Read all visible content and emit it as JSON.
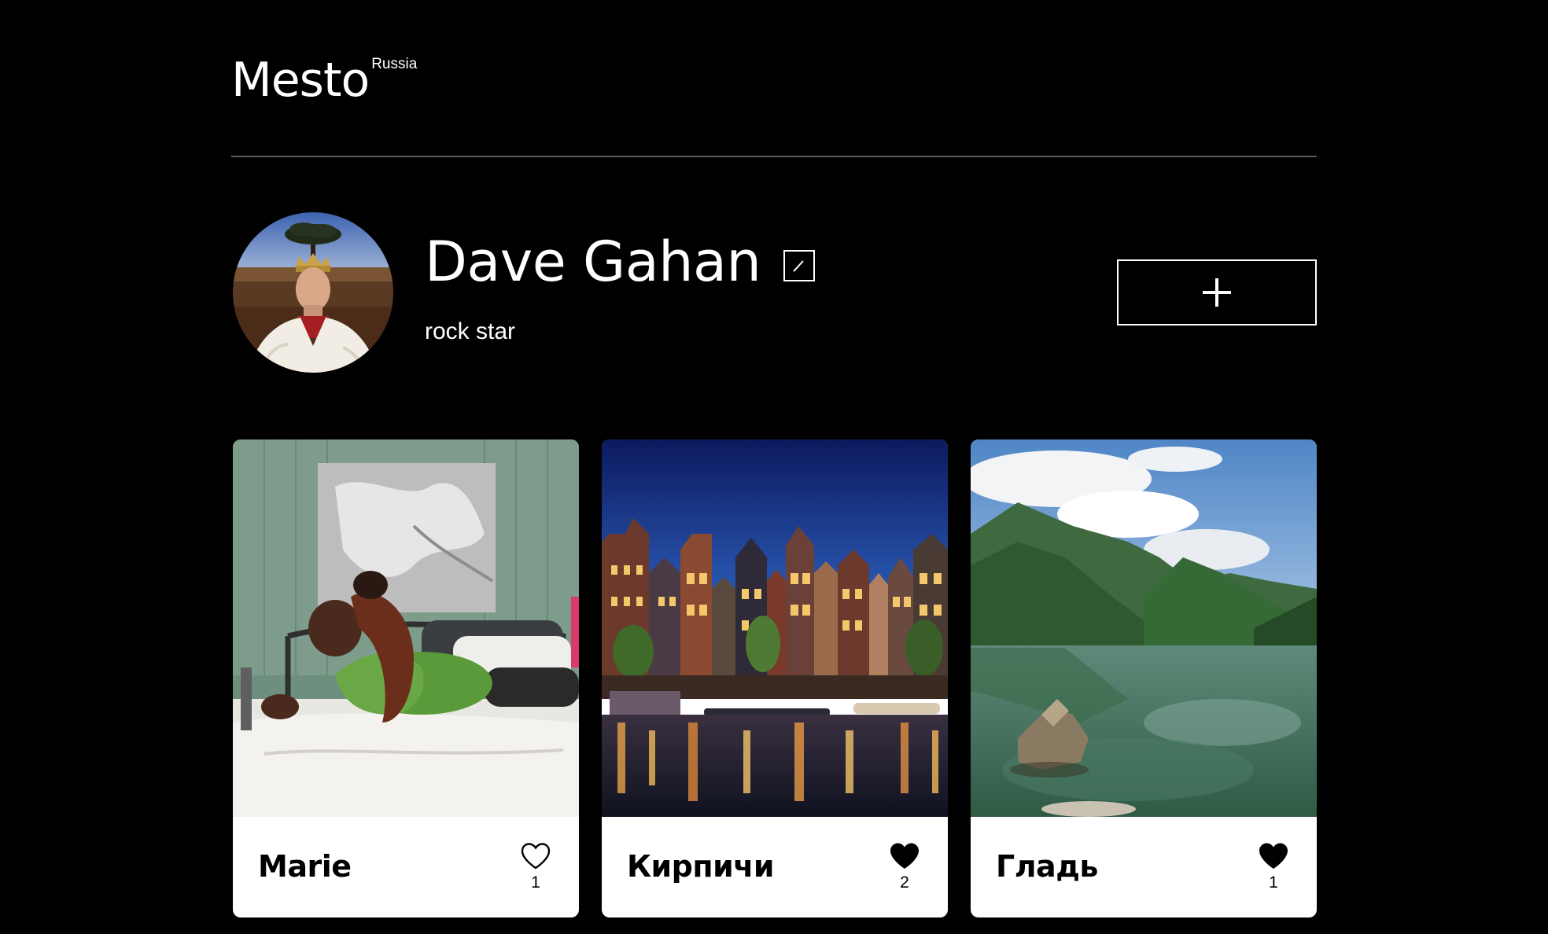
{
  "header": {
    "logo": "Mesto",
    "logo_superscript": "Russia"
  },
  "profile": {
    "name": "Dave Gahan",
    "about": "rock star",
    "edit_icon": "pencil-icon",
    "add_icon": "plus-icon"
  },
  "cards": [
    {
      "title": "Marie",
      "likes": "1",
      "liked": false
    },
    {
      "title": "Кирпичи",
      "likes": "2",
      "liked": true
    },
    {
      "title": "Гладь",
      "likes": "1",
      "liked": true
    }
  ],
  "colors": {
    "background": "#000000",
    "card": "#ffffff",
    "divider": "#5b5b5b",
    "text_light": "#ffffff",
    "text_dark": "#000000"
  }
}
